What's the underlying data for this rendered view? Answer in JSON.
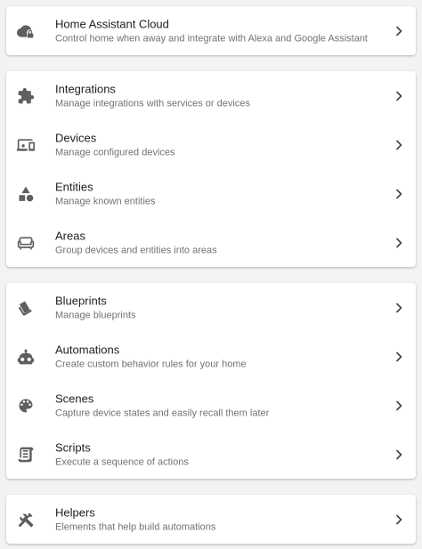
{
  "colors": {
    "background": "#f3f3f3",
    "card": "#ffffff",
    "title_text": "#212121",
    "subtitle_text": "#727272",
    "icon": "#5f5f5f"
  },
  "groups": [
    {
      "items": [
        {
          "title": "Home Assistant Cloud",
          "subtitle": "Control home when away and integrate with Alexa and Google Assistant",
          "icon": "cloud-lock-icon"
        }
      ]
    },
    {
      "items": [
        {
          "title": "Integrations",
          "subtitle": "Manage integrations with services or devices",
          "icon": "puzzle-icon"
        },
        {
          "title": "Devices",
          "subtitle": "Manage configured devices",
          "icon": "devices-icon"
        },
        {
          "title": "Entities",
          "subtitle": "Manage known entities",
          "icon": "shape-icon"
        },
        {
          "title": "Areas",
          "subtitle": "Group devices and entities into areas",
          "icon": "sofa-icon"
        }
      ]
    },
    {
      "items": [
        {
          "title": "Blueprints",
          "subtitle": "Manage blueprints",
          "icon": "blueprint-icon"
        },
        {
          "title": "Automations",
          "subtitle": "Create custom behavior rules for your home",
          "icon": "robot-icon"
        },
        {
          "title": "Scenes",
          "subtitle": "Capture device states and easily recall them later",
          "icon": "palette-icon"
        },
        {
          "title": "Scripts",
          "subtitle": "Execute a sequence of actions",
          "icon": "script-icon"
        }
      ]
    },
    {
      "items": [
        {
          "title": "Helpers",
          "subtitle": "Elements that help build automations",
          "icon": "tools-icon"
        }
      ]
    }
  ]
}
